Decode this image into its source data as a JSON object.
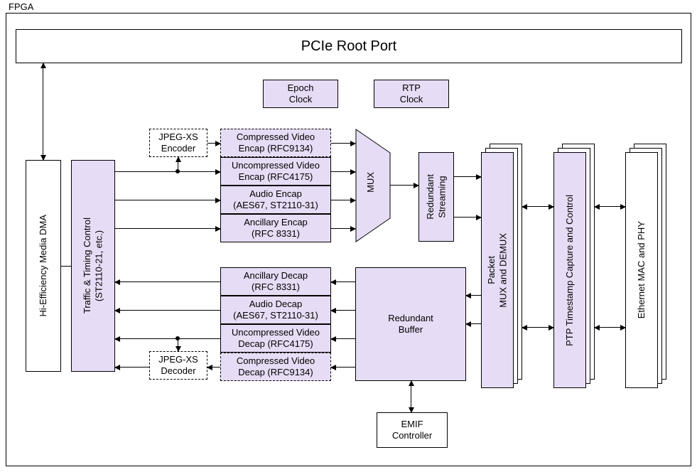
{
  "container_label": "FPGA",
  "pcie": "PCIe Root Port",
  "epoch": "Epoch\nClock",
  "rtp": "RTP\nClock",
  "media_dma": "Hi-Efficiency Media DMA",
  "traffic": "Traffic & Timing Control\n(ST2110-21, etc.)",
  "jpeg_enc": "JPEG-XS\nEncoder",
  "jpeg_dec": "JPEG-XS\nDecoder",
  "enc": {
    "cvid": "Compressed Video\nEncap (RFC9134)",
    "uvid": "Uncompressed Video\nEncap (RFC4175)",
    "aud": "Audio Encap\n(AES67, ST2110-31)",
    "anc": "Ancillary Encap\n(RFC 8331)"
  },
  "dec": {
    "anc": "Ancillary Decap\n(RFC 8331)",
    "aud": "Audio Decap\n(AES67, ST2110-31)",
    "uvid": "Uncompressed Video\nDecap (RFC4175)",
    "cvid": "Compressed Video\nDecap (RFC9134)"
  },
  "mux_label": "MUX",
  "redundant_stream": "Redundant\nStreaming",
  "redundant_buffer": "Redundant\nBuffer",
  "packet_mux": "Packet\nMUX and DEMUX",
  "ptp": "PTP Timestamp Capture and Control",
  "eth": "Ethernet MAC and PHY",
  "emif": "EMIF\nController",
  "colors": {
    "purple": "#e7dcf5"
  }
}
